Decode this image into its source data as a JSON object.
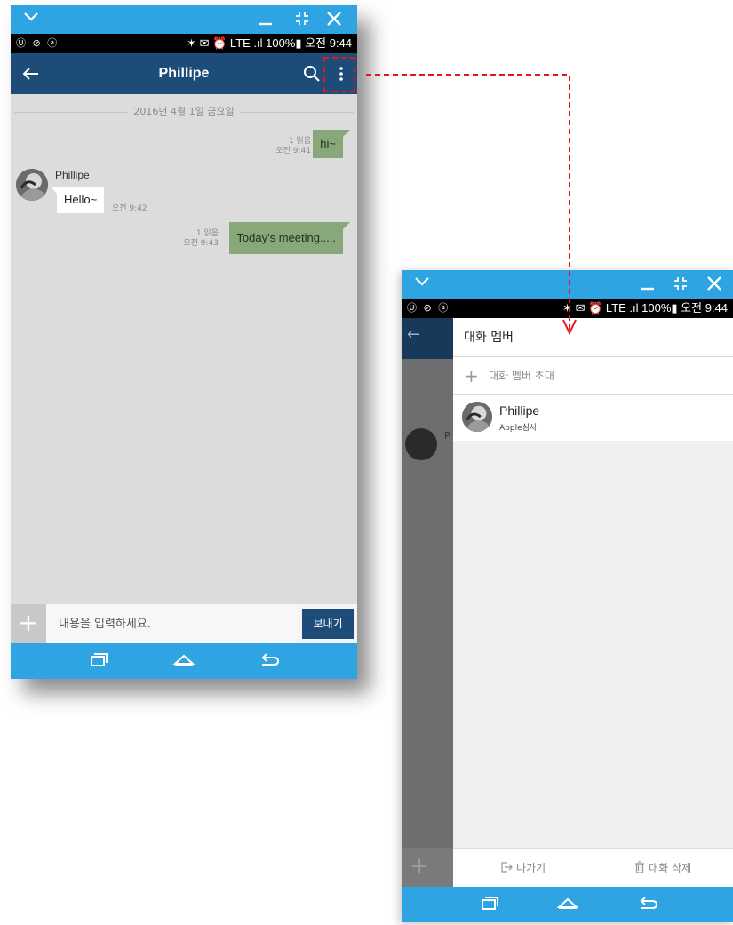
{
  "colors": {
    "window_bar": "#2ea4e2",
    "app_bar": "#1d4c79",
    "outgoing_bubble": "#88a879",
    "incoming_bubble": "#ffffff",
    "chat_background": "#dcdcdc",
    "highlight": "#e3171c"
  },
  "window_bar": {
    "collapse_icon": "chevron-down-icon",
    "minimize_icon": "minimize-icon",
    "resize_icon": "resize-icon",
    "close_icon": "close-icon"
  },
  "status_bar": {
    "left_icons": "Ⓤ ⊘ ⓐ",
    "right": "✶ ✉ ⏰ LTE .ıl 100%▮ 오전 9:44"
  },
  "chat_screen": {
    "title": "Phillipe",
    "date_separator": "2016년 4월 1일 금요일",
    "messages": [
      {
        "direction": "out",
        "text": "hi~",
        "read": "1 읽음",
        "time": "오전 9:41"
      },
      {
        "direction": "in",
        "sender": "Phillipe",
        "text": "Hello~",
        "time": "오전 9:42"
      },
      {
        "direction": "out",
        "text": "Today's meeting.....",
        "read": "1 읽음",
        "time": "오전 9:43"
      }
    ],
    "input_placeholder": "내용을 입력하세요.",
    "send_label": "보내기"
  },
  "drawer_screen": {
    "title": "대화 멤버",
    "invite_label": "대화 멤버 초대",
    "members": [
      {
        "name": "Phillipe",
        "subtitle": "Apple심사"
      }
    ],
    "leave_label": "나가기",
    "delete_label": "대화 삭제",
    "background_peek_letter": "P"
  },
  "nav_bar": {
    "recent_icon": "recent-apps-icon",
    "home_icon": "home-icon",
    "back_icon": "back-icon"
  }
}
